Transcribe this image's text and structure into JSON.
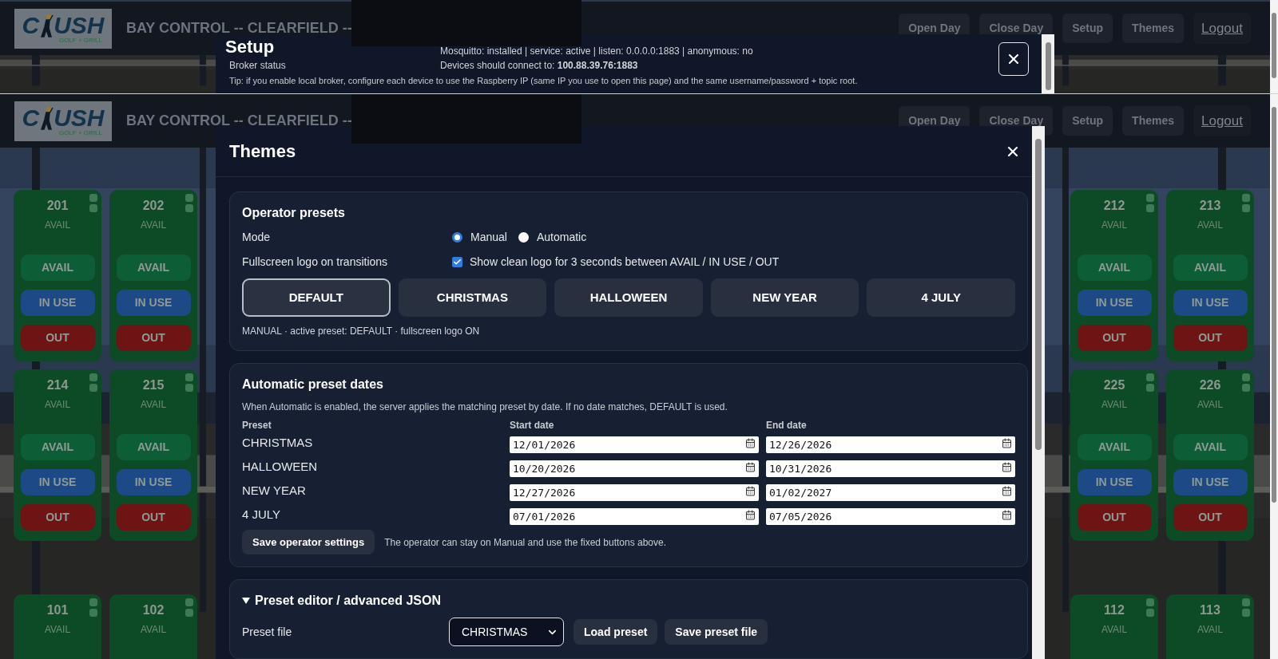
{
  "setup_screen": {
    "header": {
      "logo": {
        "left": "C",
        "right": "USH",
        "tagline": "GOLF + GRILL"
      },
      "title": "BAY CONTROL -- CLEARFIELD --",
      "actions": [
        {
          "label": "Open Day",
          "kind": "button"
        },
        {
          "label": "Close Day",
          "kind": "button"
        },
        {
          "label": "Setup",
          "kind": "button"
        },
        {
          "label": "Themes",
          "kind": "button"
        },
        {
          "label": "Logout",
          "kind": "link"
        }
      ]
    },
    "modal": {
      "title": "Setup",
      "rows": [
        {
          "label": "Broker status",
          "lines": [
            "Mosquitto: installed | service: active | listen: 0.0.0.0:1883 | anonymous: no",
            "Devices should connect to: **100.88.39.76:1883**"
          ]
        }
      ],
      "tip": "Tip: if you enable local broker, configure each device to use the Raspberry IP (same IP you use to open this page) and the same username/password + topic root."
    }
  },
  "themes_screen": {
    "header": {
      "logo": {
        "left": "C",
        "right": "USH",
        "tagline": "GOLF + GRILL"
      },
      "title": "BAY CONTROL -- CLEARFIELD --",
      "actions": [
        {
          "label": "Open Day",
          "kind": "button"
        },
        {
          "label": "Close Day",
          "kind": "button"
        },
        {
          "label": "Setup",
          "kind": "button"
        },
        {
          "label": "Themes",
          "kind": "button"
        },
        {
          "label": "Logout",
          "kind": "link"
        }
      ]
    },
    "bay_rows": [
      {
        "left": [
          {
            "number": "201",
            "status": "AVAIL",
            "actions": [
              {
                "label": "AVAIL",
                "kind": "avail"
              },
              {
                "label": "IN USE",
                "kind": "in_use"
              },
              {
                "label": "OUT",
                "kind": "out"
              }
            ]
          },
          {
            "number": "202",
            "status": "AVAIL",
            "actions": [
              {
                "label": "AVAIL",
                "kind": "avail"
              },
              {
                "label": "IN USE",
                "kind": "in_use"
              },
              {
                "label": "OUT",
                "kind": "out"
              }
            ]
          }
        ],
        "right": [
          {
            "number": "212",
            "status": "AVAIL",
            "actions": [
              {
                "label": "AVAIL",
                "kind": "avail"
              },
              {
                "label": "IN USE",
                "kind": "in_use"
              },
              {
                "label": "OUT",
                "kind": "out"
              }
            ]
          },
          {
            "number": "213",
            "status": "AVAIL",
            "actions": [
              {
                "label": "AVAIL",
                "kind": "avail"
              },
              {
                "label": "IN USE",
                "kind": "in_use"
              },
              {
                "label": "OUT",
                "kind": "out"
              }
            ]
          }
        ]
      },
      {
        "left": [
          {
            "number": "214",
            "status": "AVAIL",
            "actions": [
              {
                "label": "AVAIL",
                "kind": "avail"
              },
              {
                "label": "IN USE",
                "kind": "in_use"
              },
              {
                "label": "OUT",
                "kind": "out"
              }
            ]
          },
          {
            "number": "215",
            "status": "AVAIL",
            "actions": [
              {
                "label": "AVAIL",
                "kind": "avail"
              },
              {
                "label": "IN USE",
                "kind": "in_use"
              },
              {
                "label": "OUT",
                "kind": "out"
              }
            ]
          }
        ],
        "right": [
          {
            "number": "225",
            "status": "AVAIL",
            "actions": [
              {
                "label": "AVAIL",
                "kind": "avail"
              },
              {
                "label": "IN USE",
                "kind": "in_use"
              },
              {
                "label": "OUT",
                "kind": "out"
              }
            ]
          },
          {
            "number": "226",
            "status": "AVAIL",
            "actions": [
              {
                "label": "AVAIL",
                "kind": "avail"
              },
              {
                "label": "IN USE",
                "kind": "in_use"
              },
              {
                "label": "OUT",
                "kind": "out"
              }
            ]
          }
        ]
      },
      {
        "left": [
          {
            "number": "101",
            "status": "AVAIL"
          },
          {
            "number": "102",
            "status": "AVAIL"
          }
        ],
        "right": [
          {
            "number": "112",
            "status": "AVAIL"
          },
          {
            "number": "113",
            "status": "AVAIL"
          }
        ]
      }
    ],
    "modal": {
      "title": "Themes",
      "operator_presets": {
        "title": "Operator presets",
        "mode": {
          "label": "Mode",
          "options": [
            {
              "label": "Manual",
              "selected": true
            },
            {
              "label": "Automatic",
              "selected": false
            }
          ]
        },
        "fullscreen": {
          "label": "Fullscreen logo on transitions",
          "option": "Show clean logo for 3 seconds between AVAIL / IN USE / OUT",
          "checked": true
        },
        "presets": [
          {
            "label": "DEFAULT",
            "selected": true
          },
          {
            "label": "CHRISTMAS",
            "selected": false
          },
          {
            "label": "HALLOWEEN",
            "selected": false
          },
          {
            "label": "NEW YEAR",
            "selected": false
          },
          {
            "label": "4 JULY",
            "selected": false
          }
        ],
        "status": "MANUAL · active preset: DEFAULT · fullscreen logo ON"
      },
      "automatic_dates": {
        "title": "Automatic preset dates",
        "description": "When Automatic is enabled, the server applies the matching preset by date. If no date matches, DEFAULT is used.",
        "columns": [
          "Preset",
          "Start date",
          "End date"
        ],
        "rows": [
          {
            "preset": "CHRISTMAS",
            "start": "12/01/2026",
            "end": "12/26/2026"
          },
          {
            "preset": "HALLOWEEN",
            "start": "10/20/2026",
            "end": "10/31/2026"
          },
          {
            "preset": "NEW YEAR",
            "start": "12/27/2026",
            "end": "01/02/2027"
          },
          {
            "preset": "4 JULY",
            "start": "07/01/2026",
            "end": "07/05/2026"
          }
        ],
        "save_button": "Save operator settings",
        "note": "The operator can stay on Manual and use the fixed buttons above."
      },
      "preset_editor": {
        "title": "Preset editor / advanced JSON",
        "expanded": true,
        "file_label": "Preset file",
        "file_value": "CHRISTMAS",
        "buttons": [
          "Load preset",
          "Save preset file"
        ]
      }
    }
  }
}
